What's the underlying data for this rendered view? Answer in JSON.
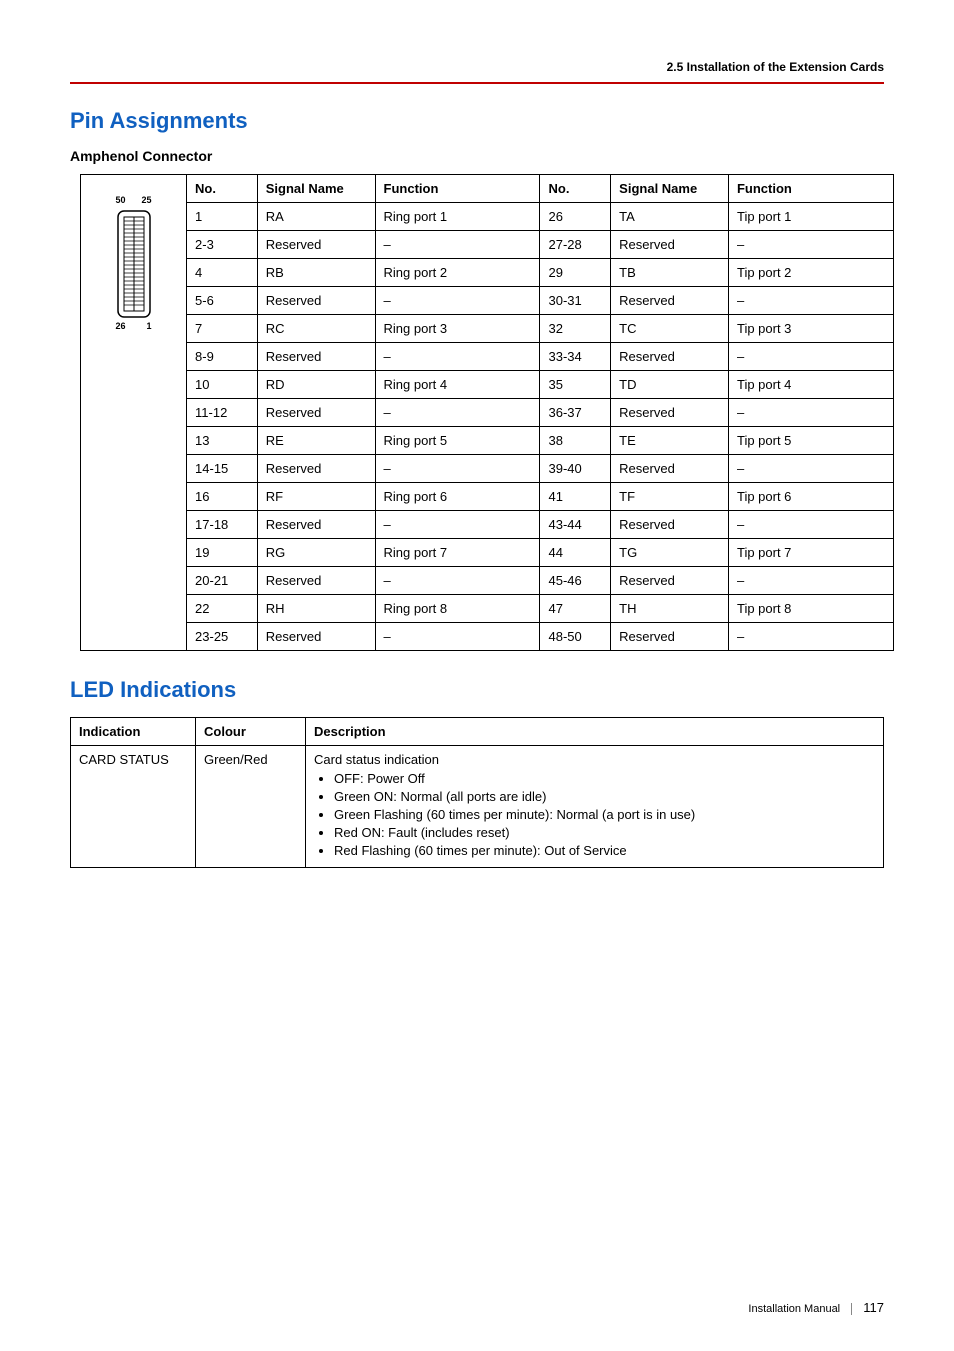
{
  "header": {
    "section": "2.5 Installation of the Extension Cards"
  },
  "sections": {
    "pin": {
      "title": "Pin Assignments",
      "subhead": "Amphenol Connector"
    },
    "led": {
      "title": "LED Indications"
    }
  },
  "connector": {
    "top_left": "50",
    "top_right": "25",
    "bottom_left": "26",
    "bottom_right": "1"
  },
  "pin_table": {
    "headers": [
      "No.",
      "Signal Name",
      "Function",
      "No.",
      "Signal Name",
      "Function"
    ],
    "rows": [
      [
        "1",
        "RA",
        "Ring port 1",
        "26",
        "TA",
        "Tip port 1"
      ],
      [
        "2-3",
        "Reserved",
        "–",
        "27-28",
        "Reserved",
        "–"
      ],
      [
        "4",
        "RB",
        "Ring port 2",
        "29",
        "TB",
        "Tip port 2"
      ],
      [
        "5-6",
        "Reserved",
        "–",
        "30-31",
        "Reserved",
        "–"
      ],
      [
        "7",
        "RC",
        "Ring port 3",
        "32",
        "TC",
        "Tip port 3"
      ],
      [
        "8-9",
        "Reserved",
        "–",
        "33-34",
        "Reserved",
        "–"
      ],
      [
        "10",
        "RD",
        "Ring port 4",
        "35",
        "TD",
        "Tip port 4"
      ],
      [
        "11-12",
        "Reserved",
        "–",
        "36-37",
        "Reserved",
        "–"
      ],
      [
        "13",
        "RE",
        "Ring port 5",
        "38",
        "TE",
        "Tip port 5"
      ],
      [
        "14-15",
        "Reserved",
        "–",
        "39-40",
        "Reserved",
        "–"
      ],
      [
        "16",
        "RF",
        "Ring port 6",
        "41",
        "TF",
        "Tip port 6"
      ],
      [
        "17-18",
        "Reserved",
        "–",
        "43-44",
        "Reserved",
        "–"
      ],
      [
        "19",
        "RG",
        "Ring port 7",
        "44",
        "TG",
        "Tip port 7"
      ],
      [
        "20-21",
        "Reserved",
        "–",
        "45-46",
        "Reserved",
        "–"
      ],
      [
        "22",
        "RH",
        "Ring port 8",
        "47",
        "TH",
        "Tip port 8"
      ],
      [
        "23-25",
        "Reserved",
        "–",
        "48-50",
        "Reserved",
        "–"
      ]
    ]
  },
  "led_table": {
    "headers": [
      "Indication",
      "Colour",
      "Description"
    ],
    "row": {
      "indication": "CARD STATUS",
      "colour": "Green/Red",
      "desc_intro": "Card status indication",
      "bullets": [
        "OFF: Power Off",
        "Green ON: Normal (all ports are idle)",
        "Green Flashing (60 times per minute): Normal (a port is in use)",
        "Red ON: Fault (includes reset)",
        "Red Flashing (60 times per minute): Out of Service"
      ]
    }
  },
  "footer": {
    "label": "Installation Manual",
    "page": "117"
  }
}
